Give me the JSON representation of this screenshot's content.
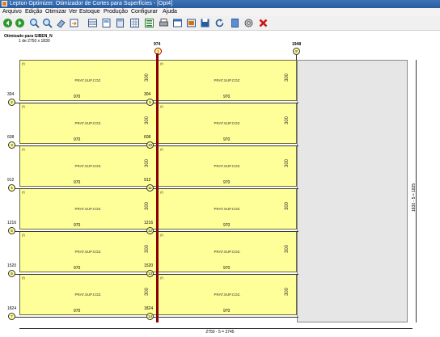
{
  "window": {
    "title": "Lepton Optimizer. Otimizador de Cortes para Superfícies - [Opt4]"
  },
  "menu": [
    "Arquivo",
    "Edição",
    "Otimizar",
    "Ver",
    "Estoque",
    "Produção",
    "Configurar",
    "Ajuda"
  ],
  "toolbar": {
    "icons": [
      "back-icon",
      "forward-icon",
      "zoom-in-icon",
      "zoom-out-icon",
      "eraser-icon",
      "export-icon",
      "table-icon",
      "sheet-icon",
      "calculator-icon",
      "grid-icon",
      "list-icon",
      "print-icon",
      "report-icon",
      "save-icon",
      "refresh-icon",
      "book-icon",
      "settings-icon",
      "close-icon"
    ]
  },
  "plan": {
    "header_line1": "Otimizado para GIBEN_N",
    "header_line2": "1 de 2750 x 1830",
    "top_x_label": "974",
    "top_x_label_right": "1948",
    "top_circle": "1",
    "top_circle_right": "8",
    "bottom_dimension": "2750 - 5 = 2745",
    "right_dimension": "1830 - 5 = 1825"
  },
  "rows": [
    {
      "y": "304",
      "num": "2",
      "mid": "5",
      "mid_y": "304"
    },
    {
      "y": "608",
      "num": "3",
      "mid": "10",
      "mid_y": "608"
    },
    {
      "y": "912",
      "num": "4",
      "mid": "11",
      "mid_y": "912"
    },
    {
      "y": "1216",
      "num": "5",
      "mid": "12",
      "mid_y": "1216"
    },
    {
      "y": "1520",
      "num": "6",
      "mid": "13",
      "mid_y": "1520"
    },
    {
      "y": "1824",
      "num": "7",
      "mid": "14",
      "mid_y": "1824"
    }
  ],
  "piece": {
    "mark": "(f)",
    "label": "PRAT.SUP.COZ.",
    "width": "970",
    "height": "300"
  }
}
